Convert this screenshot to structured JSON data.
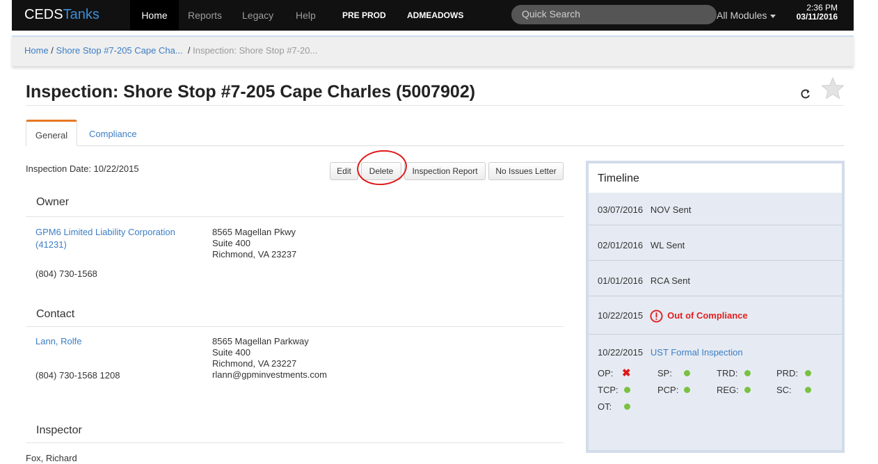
{
  "navbar": {
    "brand_part1": "CEDS",
    "brand_part2": "Tanks",
    "items": [
      "Home",
      "Reports",
      "Legacy",
      "Help"
    ],
    "env": "PRE PROD",
    "user": "ADMEADOWS",
    "search_placeholder": "Quick Search",
    "modules": "All Modules",
    "time": "2:36 PM",
    "date": "03/11/2016"
  },
  "breadcrumb": {
    "home": "Home",
    "facility": "Shore Stop #7-205 Cape Cha...",
    "current": "Inspection: Shore Stop #7-20..."
  },
  "page": {
    "title": "Inspection: Shore Stop #7-205 Cape Charles (5007902)"
  },
  "tabs": [
    "General",
    "Compliance"
  ],
  "inspection_date": "Inspection Date: 10/22/2015",
  "buttons": {
    "edit": "Edit",
    "delete": "Delete",
    "report": "Inspection Report",
    "no_issues": "No Issues Letter"
  },
  "owner": {
    "heading": "Owner",
    "name_line1": "GPM6 Limited Liability Corporation",
    "name_line2": "(41231)",
    "address1": "8565 Magellan Pkwy",
    "address2": "Suite 400",
    "address3": "Richmond, VA 23237",
    "phone": "(804) 730-1568"
  },
  "contact": {
    "heading": "Contact",
    "name": "Lann, Rolfe",
    "address1": "8565 Magellan Parkway",
    "address2": "Suite 400",
    "address3": "Richmond, VA 23227",
    "phone": "(804) 730-1568 1208",
    "email": "rlann@gpminvestments.com"
  },
  "inspector": {
    "heading": "Inspector",
    "name": "Fox, Richard"
  },
  "timeline": {
    "heading": "Timeline",
    "events": [
      {
        "date": "03/07/2016",
        "label": "NOV Sent"
      },
      {
        "date": "02/01/2016",
        "label": "WL Sent"
      },
      {
        "date": "01/01/2016",
        "label": "RCA Sent"
      },
      {
        "date": "10/22/2015",
        "label": "Out of Compliance"
      },
      {
        "date": "10/22/2015",
        "label": "UST Formal Inspection"
      }
    ],
    "status": [
      {
        "code": "OP:",
        "state": "fail"
      },
      {
        "code": "SP:",
        "state": "pass"
      },
      {
        "code": "TRD:",
        "state": "pass"
      },
      {
        "code": "PRD:",
        "state": "pass"
      },
      {
        "code": "TCP:",
        "state": "pass"
      },
      {
        "code": "PCP:",
        "state": "pass"
      },
      {
        "code": "REG:",
        "state": "pass"
      },
      {
        "code": "SC:",
        "state": "pass"
      },
      {
        "code": "OT:",
        "state": "pass"
      }
    ]
  },
  "colors": {
    "pass": "#7ac142",
    "fail": "#e01818",
    "link": "#3b7dc4",
    "tab_accent": "#e87722"
  }
}
